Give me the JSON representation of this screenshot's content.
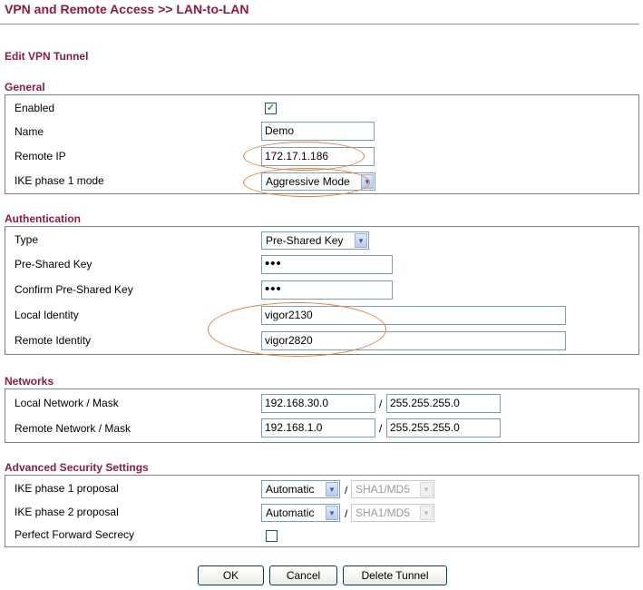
{
  "header": {
    "title": "VPN and Remote Access >> LAN-to-LAN",
    "subtitle": "Edit VPN Tunnel"
  },
  "general": {
    "title": "General",
    "enabled_label": "Enabled",
    "enabled_checked": true,
    "check_glyph": "✓",
    "name_label": "Name",
    "name_value": "Demo",
    "remote_ip_label": "Remote IP",
    "remote_ip_value": "172.17.1.186",
    "ike_mode_label": "IKE phase 1 mode",
    "ike_mode_value": "Aggressive Mode"
  },
  "authentication": {
    "title": "Authentication",
    "type_label": "Type",
    "type_value": "Pre-Shared Key",
    "psk_label": "Pre-Shared Key",
    "psk_value": "•••",
    "confirm_psk_label": "Confirm Pre-Shared Key",
    "confirm_psk_value": "•••",
    "local_identity_label": "Local Identity",
    "local_identity_value": "vigor2130",
    "remote_identity_label": "Remote Identity",
    "remote_identity_value": "vigor2820"
  },
  "networks": {
    "title": "Networks",
    "local_label": "Local Network / Mask",
    "local_network": "192.168.30.0",
    "local_mask": "255.255.255.0",
    "remote_label": "Remote Network / Mask",
    "remote_network": "192.168.1.0",
    "remote_mask": "255.255.255.0",
    "separator": "/"
  },
  "advanced": {
    "title": "Advanced Security Settings",
    "phase1_label": "IKE phase 1 proposal",
    "phase1_value": "Automatic",
    "phase1_alg": "SHA1/MD5",
    "phase2_label": "IKE phase 2 proposal",
    "phase2_value": "Automatic",
    "phase2_alg": "SHA1/MD5",
    "pfs_label": "Perfect Forward Secrecy",
    "pfs_checked": false
  },
  "buttons": {
    "ok": "OK",
    "cancel": "Cancel",
    "delete": "Delete Tunnel"
  },
  "icons": {
    "dropdown": "▼"
  },
  "colors": {
    "title": "#8b1c3a",
    "highlight_ellipse": "#e8803a",
    "input_border": "#7f9db9"
  }
}
